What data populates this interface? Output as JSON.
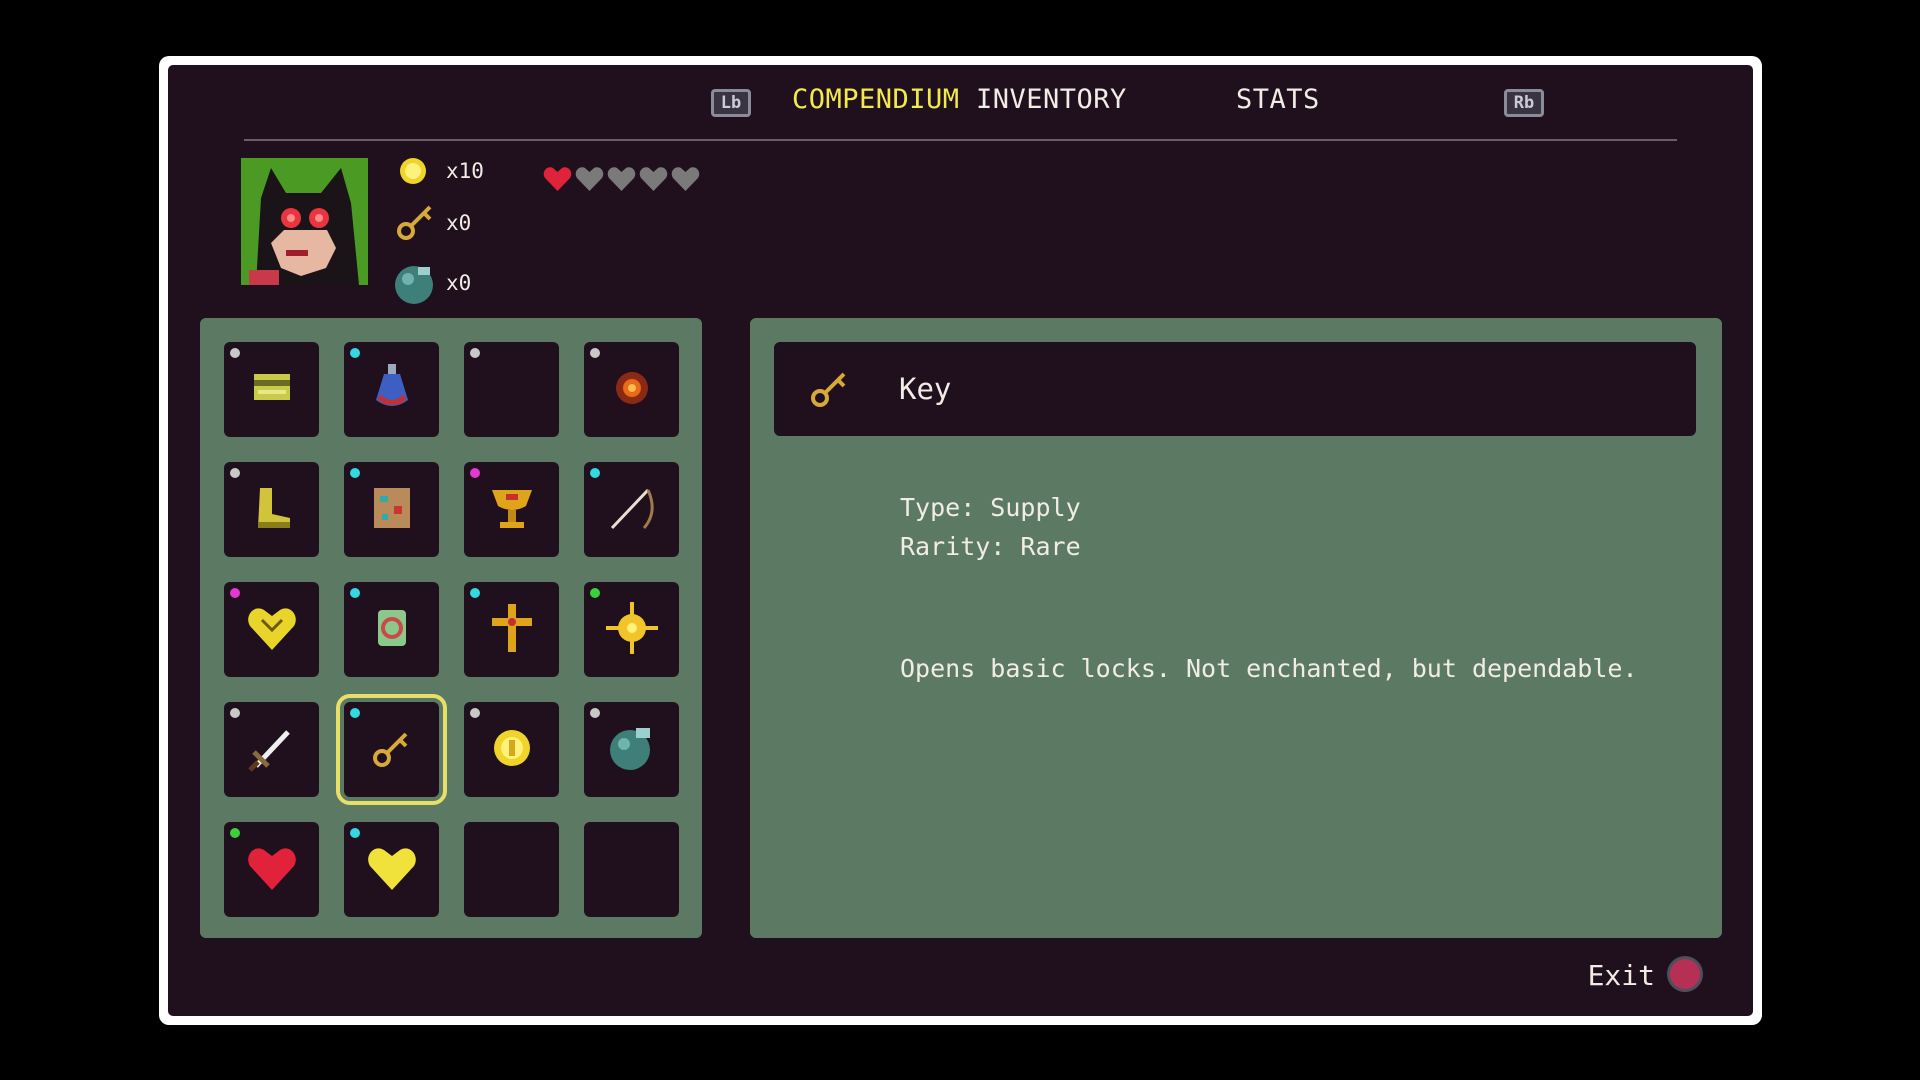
{
  "tabs": [
    {
      "label": "COMPENDIUM",
      "active": true
    },
    {
      "label": "INVENTORY",
      "active": false
    },
    {
      "label": "STATS",
      "active": false
    }
  ],
  "bumpers": {
    "left": "Lb",
    "right": "Rb"
  },
  "counters": [
    {
      "icon": "coin-icon",
      "value": "x10"
    },
    {
      "icon": "key-icon",
      "value": "x0"
    },
    {
      "icon": "bomb-icon",
      "value": "x0"
    }
  ],
  "health": {
    "filled": 1,
    "total": 5
  },
  "grid": [
    {
      "icon": "scroll-icon",
      "rarity": "#c8c8c8"
    },
    {
      "icon": "potion-icon",
      "rarity": "#32d9e0"
    },
    {
      "icon": "moon-icon",
      "rarity": "#c8c8c8"
    },
    {
      "icon": "fire-orb-icon",
      "rarity": "#c8c8c8"
    },
    {
      "icon": "boot-icon",
      "rarity": "#c8c8c8"
    },
    {
      "icon": "map-icon",
      "rarity": "#32d9e0"
    },
    {
      "icon": "chalice-icon",
      "rarity": "#e23ad0"
    },
    {
      "icon": "bow-icon",
      "rarity": "#32d9e0"
    },
    {
      "icon": "golden-heart-icon",
      "rarity": "#e23ad0"
    },
    {
      "icon": "ring-icon",
      "rarity": "#32d9e0"
    },
    {
      "icon": "cross-icon",
      "rarity": "#32d9e0"
    },
    {
      "icon": "sun-icon",
      "rarity": "#3bd13b"
    },
    {
      "icon": "sword-icon",
      "rarity": "#c8c8c8"
    },
    {
      "icon": "key-icon",
      "rarity": "#32d9e0",
      "selected": true
    },
    {
      "icon": "coin-icon",
      "rarity": "#c8c8c8"
    },
    {
      "icon": "bomb-icon",
      "rarity": "#c8c8c8"
    },
    {
      "icon": "red-heart-icon",
      "rarity": "#3bd13b"
    },
    {
      "icon": "yellow-heart-icon",
      "rarity": "#32d9e0"
    },
    {
      "icon": "",
      "rarity": ""
    },
    {
      "icon": "",
      "rarity": ""
    }
  ],
  "selected_item": {
    "name": "Key",
    "icon": "key-icon",
    "type_line": "Type: Supply",
    "rarity_line": "Rarity: Rare",
    "description": "Opens basic locks. Not enchanted, but dependable."
  },
  "exit": {
    "label": "Exit",
    "button": "B"
  },
  "colors": {
    "accent": "#f2ea4a",
    "panel": "#5c7a63",
    "background": "#200f1c"
  }
}
